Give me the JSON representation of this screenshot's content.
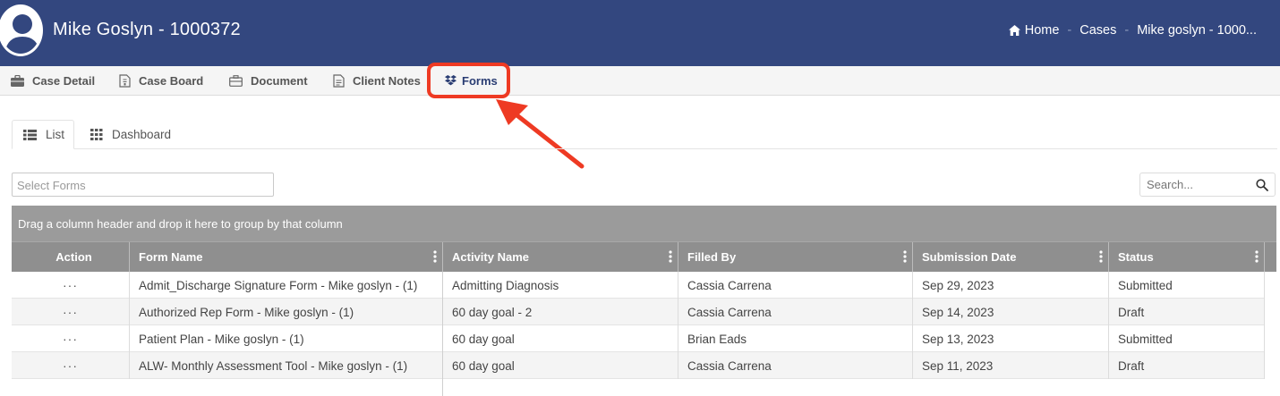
{
  "header": {
    "title": "Mike Goslyn - 1000372",
    "breadcrumb": [
      {
        "label": "Home",
        "icon": "home-icon"
      },
      {
        "label": "Cases"
      },
      {
        "label": "Mike goslyn - 1000..."
      }
    ],
    "background": "#33477f"
  },
  "tabs": [
    {
      "label": "Case Detail",
      "icon": "briefcase-icon"
    },
    {
      "label": "Case Board",
      "icon": "document-icon"
    },
    {
      "label": "Document",
      "icon": "folder-briefcase-icon"
    },
    {
      "label": "Client Notes",
      "icon": "notes-icon"
    },
    {
      "label": "Forms",
      "icon": "dropbox-icon",
      "active": true
    }
  ],
  "subtabs": [
    {
      "label": "List",
      "icon": "list-icon",
      "active": true
    },
    {
      "label": "Dashboard",
      "icon": "grid-icon"
    }
  ],
  "filters": {
    "select_placeholder": "Select Forms",
    "search_placeholder": "Search..."
  },
  "grid": {
    "group_hint": "Drag a column header and drop it here to group by that column",
    "columns": [
      "Action",
      "Form Name",
      "Activity Name",
      "Filled By",
      "Submission Date",
      "Status"
    ],
    "rows": [
      {
        "action": "···",
        "form_name": "Admit_Discharge Signature Form - Mike goslyn - (1)",
        "activity": "Admitting Diagnosis",
        "filled_by": "Cassia Carrena",
        "date": "Sep 29, 2023",
        "status": "Submitted"
      },
      {
        "action": "···",
        "form_name": "Authorized Rep Form - Mike goslyn - (1)",
        "activity": "60 day goal - 2",
        "filled_by": "Cassia Carrena",
        "date": "Sep 14, 2023",
        "status": "Draft"
      },
      {
        "action": "···",
        "form_name": "Patient Plan - Mike goslyn - (1)",
        "activity": "60 day goal",
        "filled_by": "Brian Eads",
        "date": "Sep 13, 2023",
        "status": "Submitted"
      },
      {
        "action": "···",
        "form_name": "ALW- Monthly Assessment Tool - Mike goslyn - (1)",
        "activity": "60 day goal",
        "filled_by": "Cassia Carrena",
        "date": "Sep 11, 2023",
        "status": "Draft"
      }
    ]
  },
  "annotation_color": "#ee3a23"
}
